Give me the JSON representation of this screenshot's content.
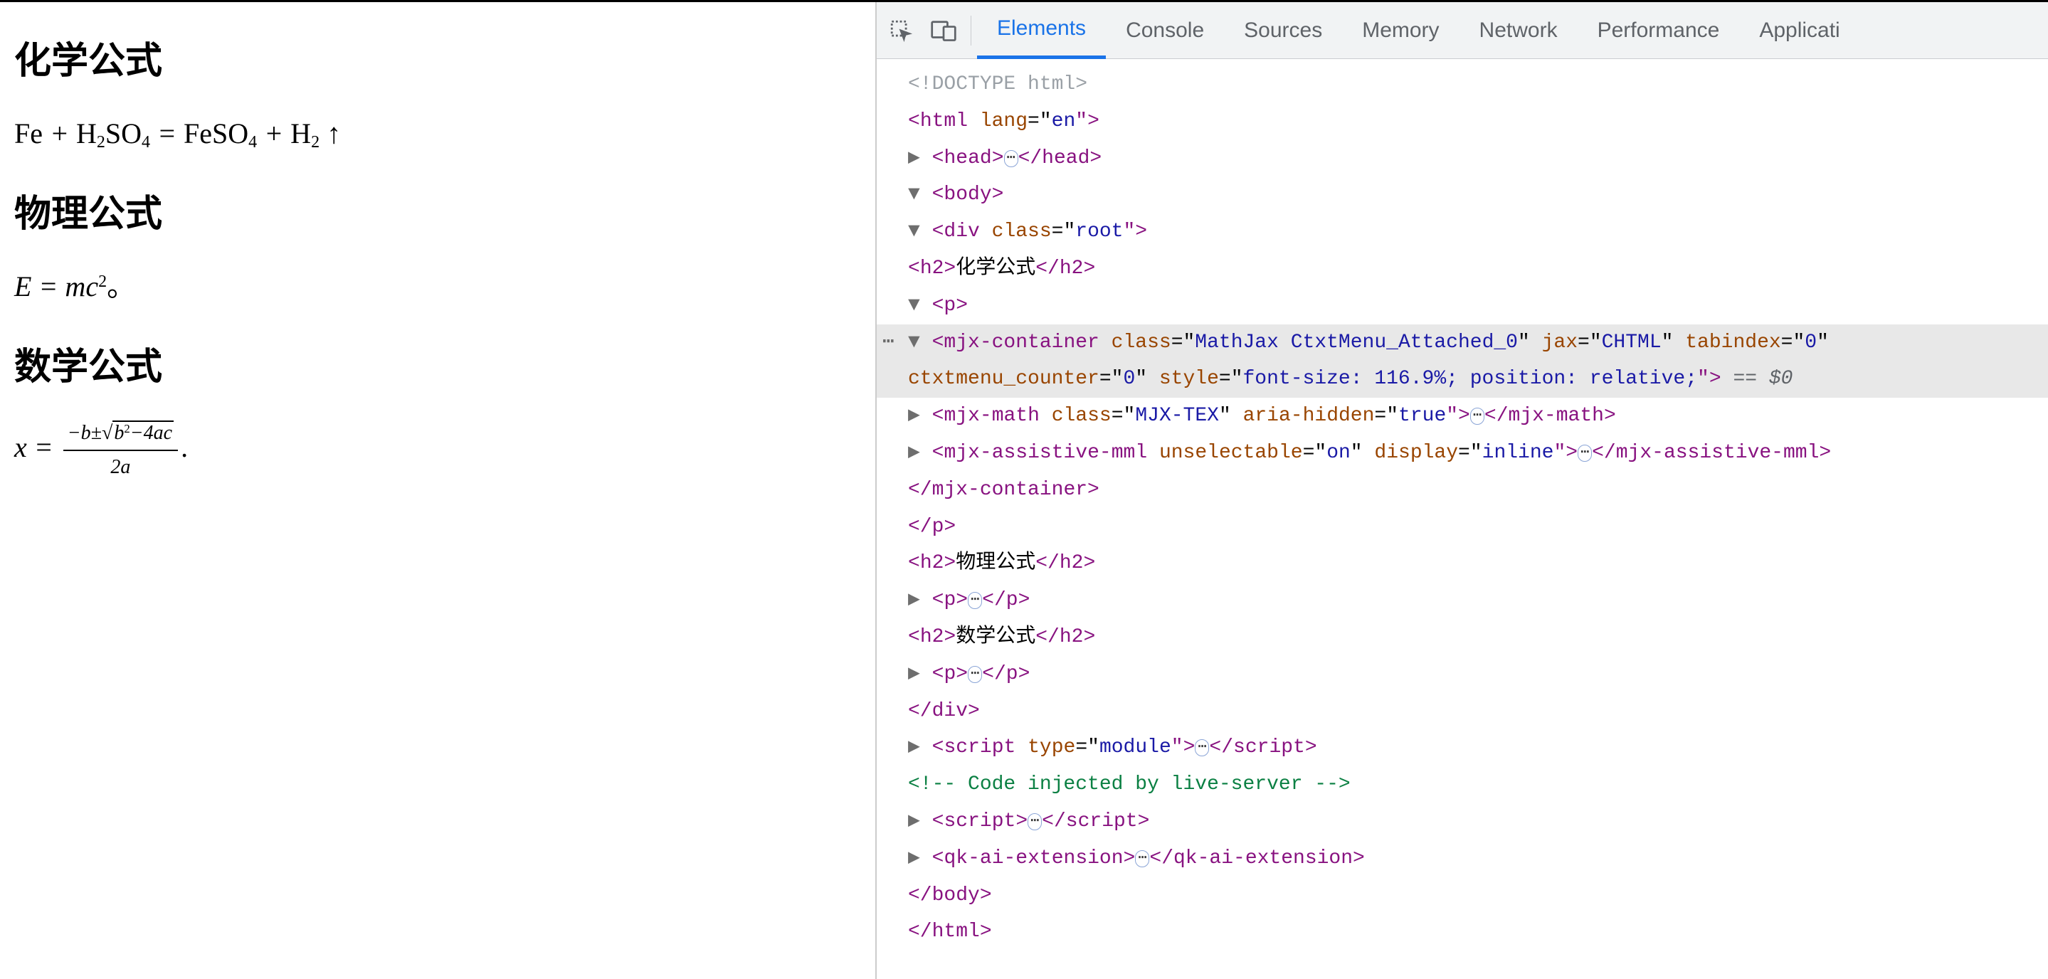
{
  "page": {
    "headings": {
      "chem": "化学公式",
      "phys": "物理公式",
      "math": "数学公式"
    },
    "formulas": {
      "chem_html": "<span class='rm'>Fe</span> + <span class='rm'>H</span><sub>2</sub><span class='rm'>SO</span><sub>4</sub> = <span class='rm'>FeSO</span><sub>4</sub> + <span class='rm'>H</span><sub>2</sub> <span class='rm'>↑</span>",
      "phys_html": "E = mc<sup>2</sup><span class='period'>。</span>",
      "math_html": "x = <span class='frac'><span class='num'>−b±<span class='sqrt'><span class='radicand'>b<sup>2</sup>−4ac</span></span></span><span class='den'>2a</span></span><span class='period'>.</span>"
    }
  },
  "devtools": {
    "tabs": [
      "Elements",
      "Console",
      "Sources",
      "Memory",
      "Network",
      "Performance",
      "Applicati"
    ],
    "active_tab": 0
  },
  "dom": {
    "l0": "<!DOCTYPE html>",
    "l1a": "<",
    "l1b": "html ",
    "l1c": "lang",
    "l1d": "=\"",
    "l1e": "en",
    "l1f": "\">",
    "l2t": "▶ ",
    "l2a": "<",
    "l2b": "head",
    "l2c": ">",
    "l2p": "⋯",
    "l2d": "</",
    "l2e": "head",
    "l2f": ">",
    "l3t": "▼ ",
    "l3a": "<",
    "l3b": "body",
    "l3c": ">",
    "l4t": "▼ ",
    "l4a": "<",
    "l4b": "div ",
    "l4c": "class",
    "l4d": "=\"",
    "l4e": "root",
    "l4f": "\">",
    "l5a": "<",
    "l5b": "h2",
    "l5c": ">",
    "l5d": "化学公式",
    "l5e": "</",
    "l5f": "h2",
    "l5g": ">",
    "l6t": "▼ ",
    "l6a": "<",
    "l6b": "p",
    "l6c": ">",
    "l7t": "▼ ",
    "l7a": "<",
    "l7b": "mjx-container ",
    "l7c": "class",
    "l7d": "=\"",
    "l7e": "MathJax CtxtMenu_Attached_0",
    "l7f": "\" ",
    "l7g": "jax",
    "l7h": "=\"",
    "l7i": "CHTML",
    "l7j": "\" ",
    "l7k": "tabindex",
    "l7l": "=\"",
    "l7m": "0",
    "l7n": "\"",
    "l8a": "ctxtmenu_counter",
    "l8b": "=\"",
    "l8c": "0",
    "l8d": "\" ",
    "l8e": "style",
    "l8f": "=\"",
    "l8g": "font-size: 116.9%; position: relative;",
    "l8h": "\"> ",
    "l8i": "== ",
    "l8j": "$0",
    "l9t": "▶ ",
    "l9a": "<",
    "l9b": "mjx-math ",
    "l9c": "class",
    "l9d": "=\"",
    "l9e": "MJX-TEX",
    "l9f": "\" ",
    "l9g": "aria-hidden",
    "l9h": "=\"",
    "l9i": "true",
    "l9j": "\">",
    "l9p": "⋯",
    "l9k": "</",
    "l9l": "mjx-math",
    "l9m": ">",
    "l10t": "▶ ",
    "l10a": "<",
    "l10b": "mjx-assistive-mml ",
    "l10c": "unselectable",
    "l10d": "=\"",
    "l10e": "on",
    "l10f": "\" ",
    "l10g": "display",
    "l10h": "=\"",
    "l10i": "inline",
    "l10j": "\">",
    "l10p": "⋯",
    "l10k": "</",
    "l10l": "mjx-assistive-mml",
    "l10m": ">",
    "l11a": "</",
    "l11b": "mjx-container",
    "l11c": ">",
    "l12a": "</",
    "l12b": "p",
    "l12c": ">",
    "l13a": "<",
    "l13b": "h2",
    "l13c": ">",
    "l13d": "物理公式",
    "l13e": "</",
    "l13f": "h2",
    "l13g": ">",
    "l14t": "▶ ",
    "l14a": "<",
    "l14b": "p",
    "l14c": ">",
    "l14p": "⋯",
    "l14d": "</",
    "l14e": "p",
    "l14f": ">",
    "l15a": "<",
    "l15b": "h2",
    "l15c": ">",
    "l15d": "数学公式",
    "l15e": "</",
    "l15f": "h2",
    "l15g": ">",
    "l16t": "▶ ",
    "l16a": "<",
    "l16b": "p",
    "l16c": ">",
    "l16p": "⋯",
    "l16d": "</",
    "l16e": "p",
    "l16f": ">",
    "l17a": "</",
    "l17b": "div",
    "l17c": ">",
    "l18t": "▶ ",
    "l18a": "<",
    "l18b": "script ",
    "l18c": "type",
    "l18d": "=\"",
    "l18e": "module",
    "l18f": "\">",
    "l18p": "⋯",
    "l18g": "</",
    "l18h": "script",
    "l18i": ">",
    "l19": "<!-- Code injected by live-server -->",
    "l20t": "▶ ",
    "l20a": "<",
    "l20b": "script",
    "l20c": ">",
    "l20p": "⋯",
    "l20d": "</",
    "l20e": "script",
    "l20f": ">",
    "l21t": "▶ ",
    "l21a": "<",
    "l21b": "qk-ai-extension",
    "l21c": ">",
    "l21p": "⋯",
    "l21d": "</",
    "l21e": "qk-ai-extension",
    "l21f": ">",
    "l22a": "</",
    "l22b": "body",
    "l22c": ">",
    "l23a": "</",
    "l23b": "html",
    "l23c": ">"
  }
}
